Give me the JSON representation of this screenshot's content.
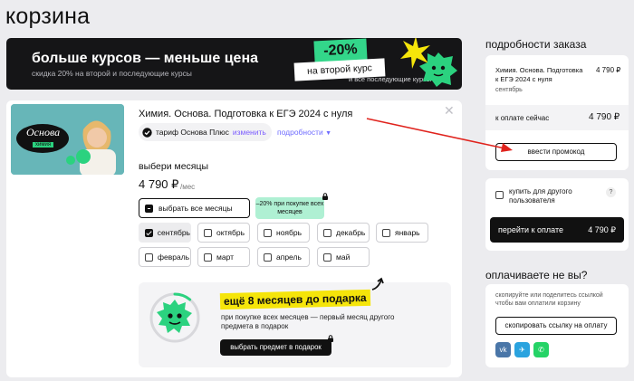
{
  "page": {
    "title": "корзина"
  },
  "banner": {
    "title": "больше курсов — меньше цена",
    "subtitle": "скидка 20% на второй и последующие курсы",
    "discount": "-20%",
    "second_course": "на второй курс",
    "and_more": "и все последующие курсы"
  },
  "course": {
    "title": "Химия. Основа. Подготовка к ЕГЭ 2024 с нуля",
    "thumb_label": "Основа",
    "thumb_sub": "химия",
    "tariff": "тариф Основа Плюс",
    "change": "изменить",
    "details": "подробности",
    "months_label": "выбери месяцы",
    "price": "4 790 ₽",
    "per_month": "/мес",
    "select_all": "выбрать все месяцы",
    "promo_badge": "–20% при покупке всех месяцев",
    "months": [
      {
        "label": "сентябрь",
        "checked": true
      },
      {
        "label": "октябрь",
        "checked": false
      },
      {
        "label": "ноябрь",
        "checked": false
      },
      {
        "label": "декабрь",
        "checked": false
      },
      {
        "label": "январь",
        "checked": false
      },
      {
        "label": "февраль",
        "checked": false
      },
      {
        "label": "март",
        "checked": false
      },
      {
        "label": "апрель",
        "checked": false
      },
      {
        "label": "май",
        "checked": false
      }
    ]
  },
  "gift": {
    "title": "ещё 8 месяцев до подарка",
    "description": "при покупке всех месяцев — первый месяц другого предмета в подарок",
    "button": "выбрать предмет в подарок",
    "progress": 0.11
  },
  "order": {
    "heading": "подробности заказа",
    "item_name": "Химия. Основа. Подготовка к ЕГЭ 2024 с нуля",
    "item_price": "4 790 ₽",
    "item_month": "сентябрь",
    "pay_now_label": "к оплате сейчас",
    "pay_now_value": "4 790 ₽",
    "promo_button": "ввести промокод",
    "buy_for_other": "купить для другого пользователя",
    "help": "?",
    "go_pay": "перейти к оплате",
    "go_pay_price": "4 790 ₽"
  },
  "share": {
    "heading": "оплачиваете не вы?",
    "description": "скопируйте или поделитесь ссылкой чтобы вам оплатили корзину",
    "copy_button": "скопировать ссылку на оплату",
    "networks": [
      {
        "name": "vk-icon",
        "label": "vk",
        "color": "#4a76a8"
      },
      {
        "name": "telegram-icon",
        "label": "✈",
        "color": "#2aa3df"
      },
      {
        "name": "whatsapp-icon",
        "label": "✆",
        "color": "#25d366"
      }
    ]
  },
  "colors": {
    "accent": "#2bd27f",
    "link": "#6f6cff",
    "highlight": "#f5e50a",
    "arrow": "#e0231d"
  }
}
